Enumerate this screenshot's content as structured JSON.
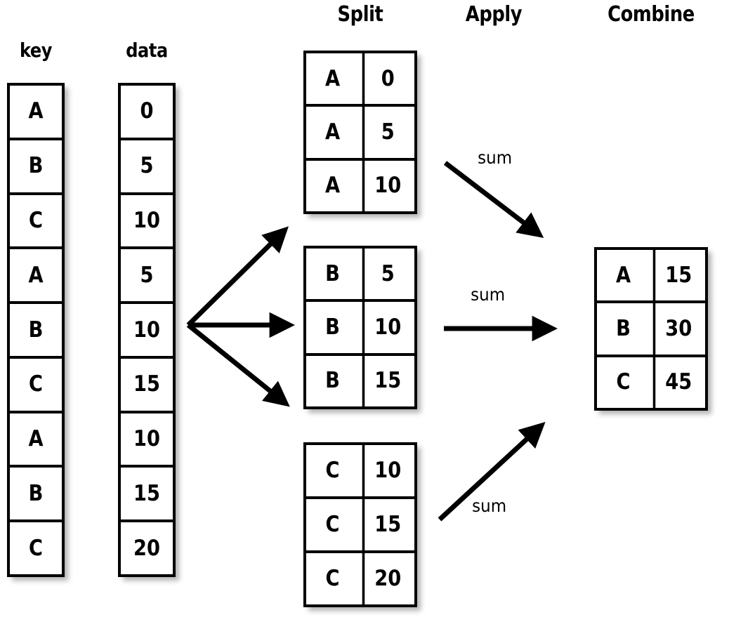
{
  "headings": {
    "key": "key",
    "data": "data",
    "split": "Split",
    "apply": "Apply",
    "combine": "Combine"
  },
  "colors": {
    "stroke": "#000000",
    "fill": "#ffffff",
    "shadow": "rgba(0,0,0,0.30)"
  },
  "source": {
    "key_column": {
      "header": "key",
      "values": [
        "A",
        "B",
        "C",
        "A",
        "B",
        "C",
        "A",
        "B",
        "C"
      ]
    },
    "data_column": {
      "header": "data",
      "values": [
        "0",
        "5",
        "10",
        "5",
        "10",
        "15",
        "10",
        "15",
        "20"
      ]
    }
  },
  "split_groups": [
    {
      "group": "A",
      "rows": [
        {
          "key": "A",
          "value": "0"
        },
        {
          "key": "A",
          "value": "5"
        },
        {
          "key": "A",
          "value": "10"
        }
      ]
    },
    {
      "group": "B",
      "rows": [
        {
          "key": "B",
          "value": "5"
        },
        {
          "key": "B",
          "value": "10"
        },
        {
          "key": "B",
          "value": "15"
        }
      ]
    },
    {
      "group": "C",
      "rows": [
        {
          "key": "C",
          "value": "10"
        },
        {
          "key": "C",
          "value": "15"
        },
        {
          "key": "C",
          "value": "20"
        }
      ]
    }
  ],
  "apply_labels": [
    "sum",
    "sum",
    "sum"
  ],
  "combine_table": {
    "header": "Combine",
    "rows": [
      {
        "key": "A",
        "value": "15"
      },
      {
        "key": "B",
        "value": "30"
      },
      {
        "key": "C",
        "value": "45"
      }
    ]
  }
}
